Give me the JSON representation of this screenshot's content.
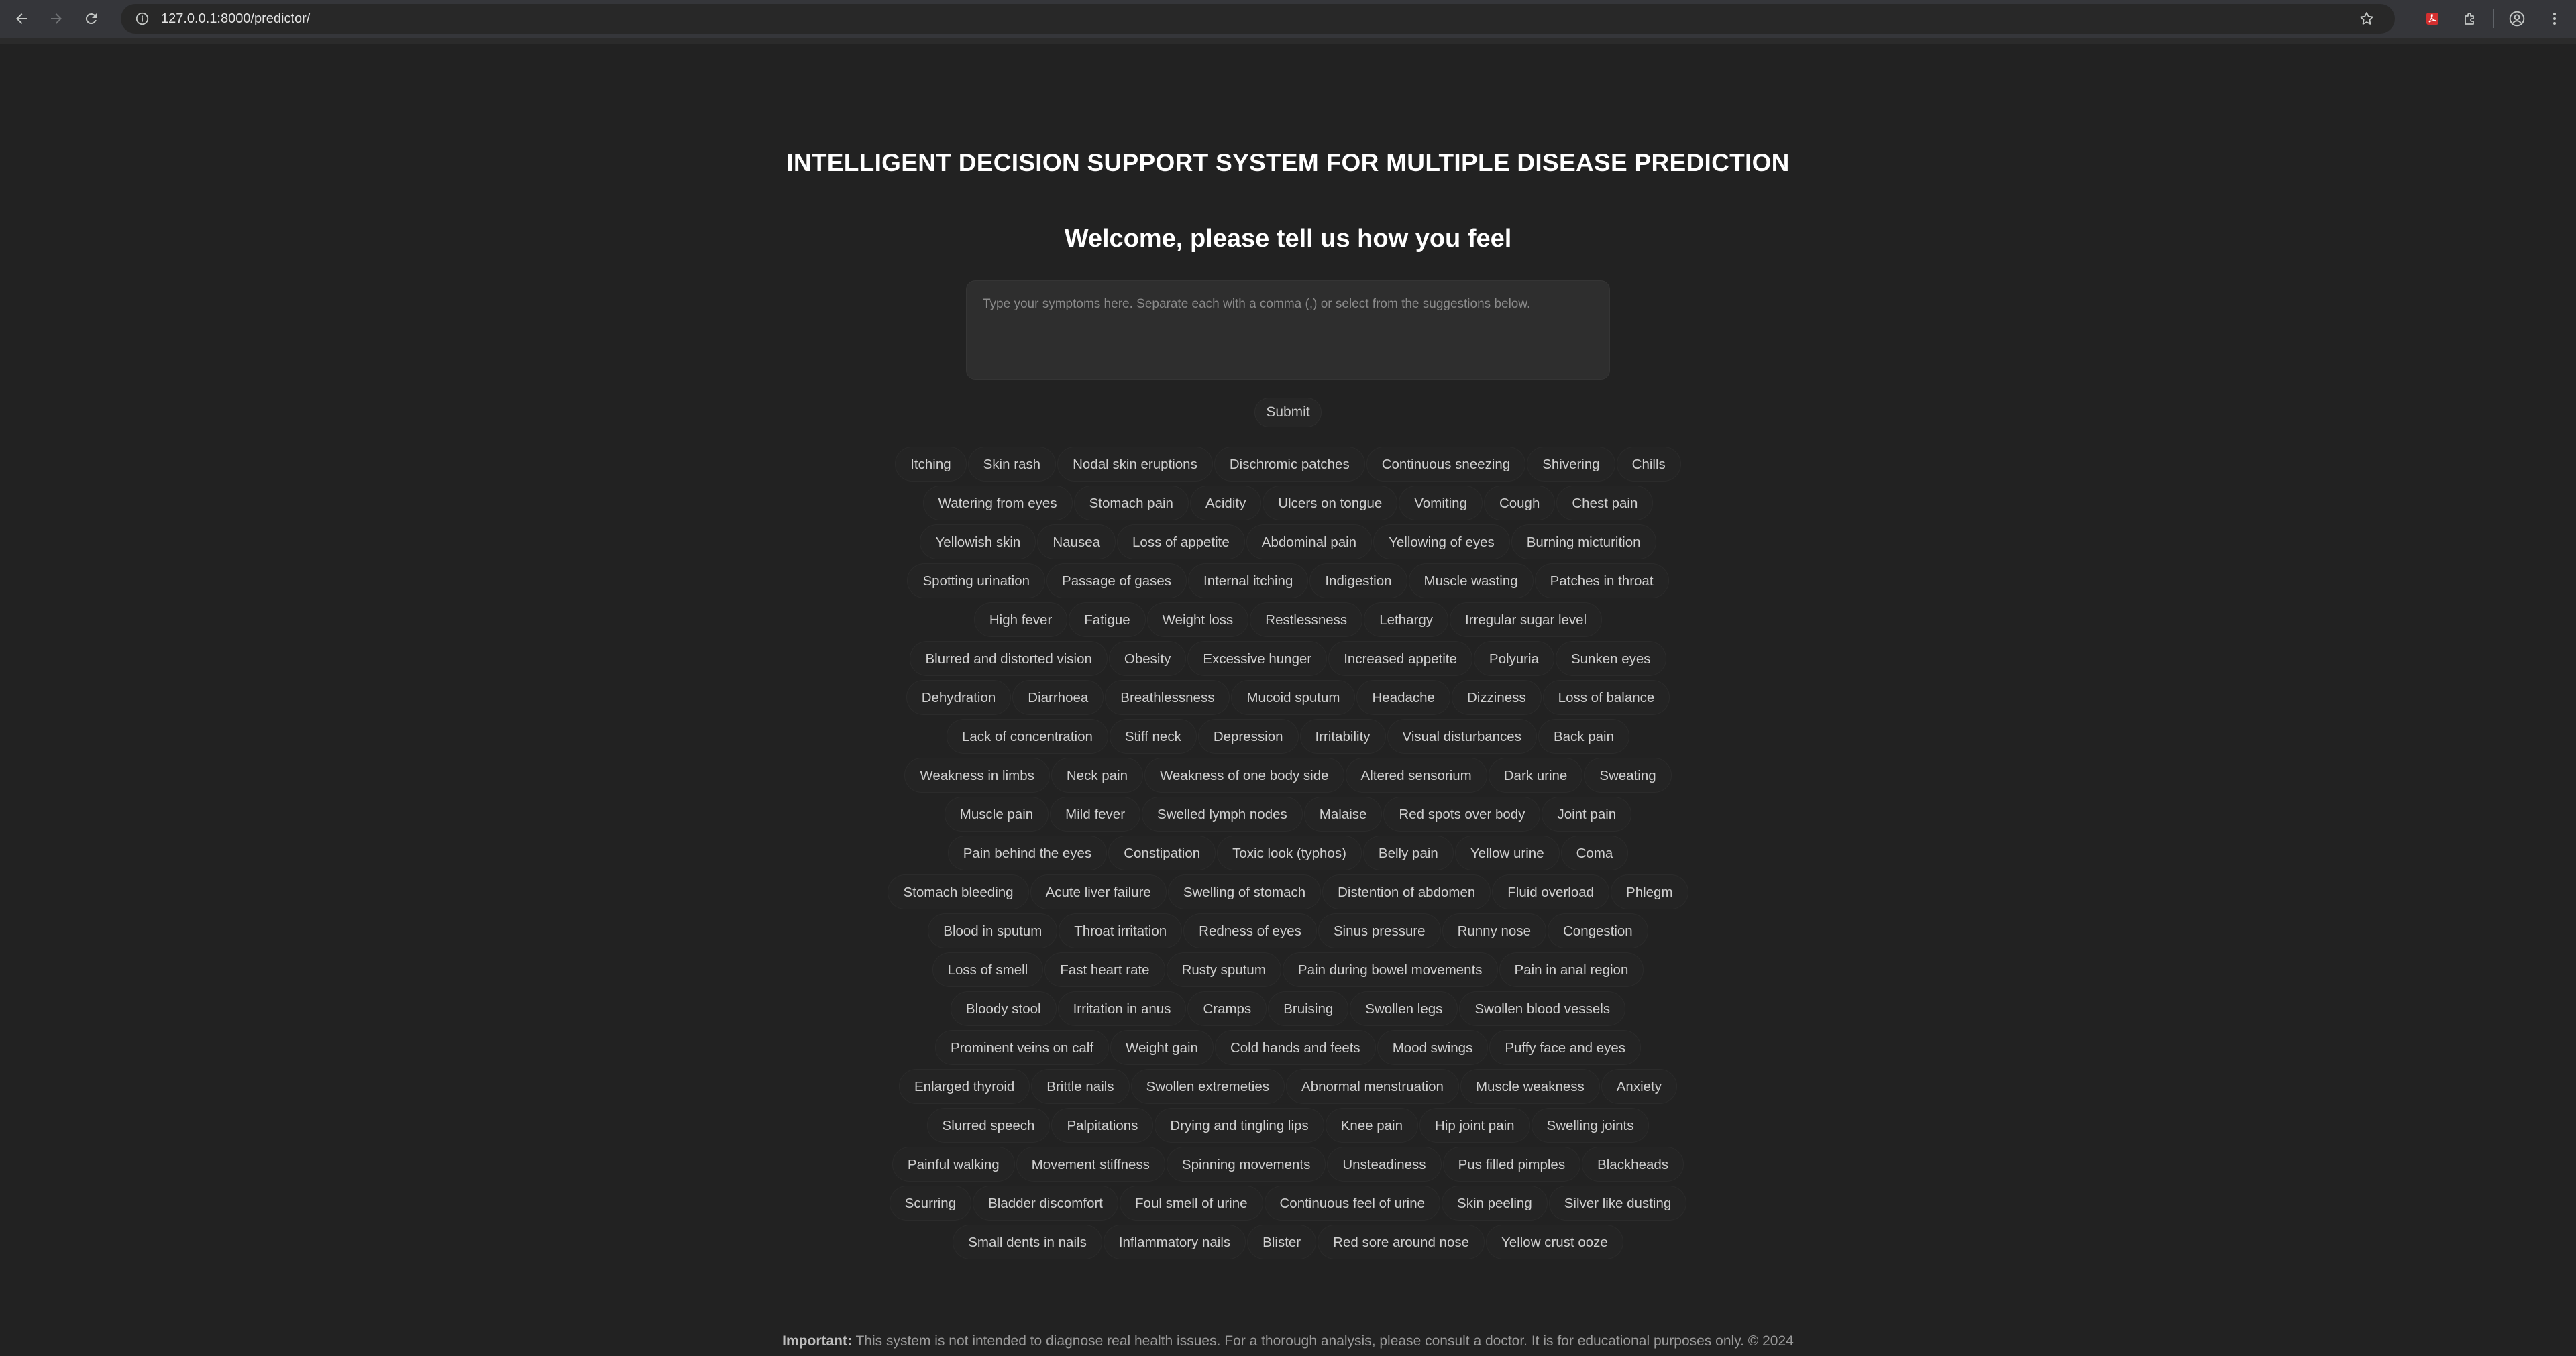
{
  "browser": {
    "url": "127.0.0.1:8000/predictor/",
    "icons": [
      "back-arrow-icon",
      "forward-arrow-icon",
      "reload-icon",
      "site-info-icon",
      "bookmark-star-icon",
      "pdf-extension-icon",
      "extensions-puzzle-icon",
      "profile-icon",
      "kebab-menu-icon"
    ],
    "pdf_icon_color": "#d32f2f"
  },
  "page": {
    "title": "INTELLIGENT DECISION SUPPORT SYSTEM FOR MULTIPLE DISEASE PREDICTION",
    "welcome": "Welcome, please tell us how you feel",
    "input_placeholder": "Type your symptoms here. Separate each with a comma (,) or select from the suggestions below.",
    "input_value": "",
    "submit_label": "Submit",
    "background_color": "#222222"
  },
  "suggestions": [
    "Itching",
    "Skin rash",
    "Nodal skin eruptions",
    "Dischromic patches",
    "Continuous sneezing",
    "Shivering",
    "Chills",
    "Watering from eyes",
    "Stomach pain",
    "Acidity",
    "Ulcers on tongue",
    "Vomiting",
    "Cough",
    "Chest pain",
    "Yellowish skin",
    "Nausea",
    "Loss of appetite",
    "Abdominal pain",
    "Yellowing of eyes",
    "Burning micturition",
    "Spotting urination",
    "Passage of gases",
    "Internal itching",
    "Indigestion",
    "Muscle wasting",
    "Patches in throat",
    "High fever",
    "Fatigue",
    "Weight loss",
    "Restlessness",
    "Lethargy",
    "Irregular sugar level",
    "Blurred and distorted vision",
    "Obesity",
    "Excessive hunger",
    "Increased appetite",
    "Polyuria",
    "Sunken eyes",
    "Dehydration",
    "Diarrhoea",
    "Breathlessness",
    "Mucoid sputum",
    "Headache",
    "Dizziness",
    "Loss of balance",
    "Lack of concentration",
    "Stiff neck",
    "Depression",
    "Irritability",
    "Visual disturbances",
    "Back pain",
    "Weakness in limbs",
    "Neck pain",
    "Weakness of one body side",
    "Altered sensorium",
    "Dark urine",
    "Sweating",
    "Muscle pain",
    "Mild fever",
    "Swelled lymph nodes",
    "Malaise",
    "Red spots over body",
    "Joint pain",
    "Pain behind the eyes",
    "Constipation",
    "Toxic look (typhos)",
    "Belly pain",
    "Yellow urine",
    "Coma",
    "Stomach bleeding",
    "Acute liver failure",
    "Swelling of stomach",
    "Distention of abdomen",
    "Fluid overload",
    "Phlegm",
    "Blood in sputum",
    "Throat irritation",
    "Redness of eyes",
    "Sinus pressure",
    "Runny nose",
    "Congestion",
    "Loss of smell",
    "Fast heart rate",
    "Rusty sputum",
    "Pain during bowel movements",
    "Pain in anal region",
    "Bloody stool",
    "Irritation in anus",
    "Cramps",
    "Bruising",
    "Swollen legs",
    "Swollen blood vessels",
    "Prominent veins on calf",
    "Weight gain",
    "Cold hands and feets",
    "Mood swings",
    "Puffy face and eyes",
    "Enlarged thyroid",
    "Brittle nails",
    "Swollen extremeties",
    "Abnormal menstruation",
    "Muscle weakness",
    "Anxiety",
    "Slurred speech",
    "Palpitations",
    "Drying and tingling lips",
    "Knee pain",
    "Hip joint pain",
    "Swelling joints",
    "Painful walking",
    "Movement stiffness",
    "Spinning movements",
    "Unsteadiness",
    "Pus filled pimples",
    "Blackheads",
    "Scurring",
    "Bladder discomfort",
    "Foul smell of urine",
    "Continuous feel of urine",
    "Skin peeling",
    "Silver like dusting",
    "Small dents in nails",
    "Inflammatory nails",
    "Blister",
    "Red sore around nose",
    "Yellow crust ooze"
  ],
  "footer": {
    "important_label": "Important:",
    "text": " This system is not intended to diagnose real health issues. For a thorough analysis, please consult a doctor. It is for educational purposes only. © 2024"
  }
}
